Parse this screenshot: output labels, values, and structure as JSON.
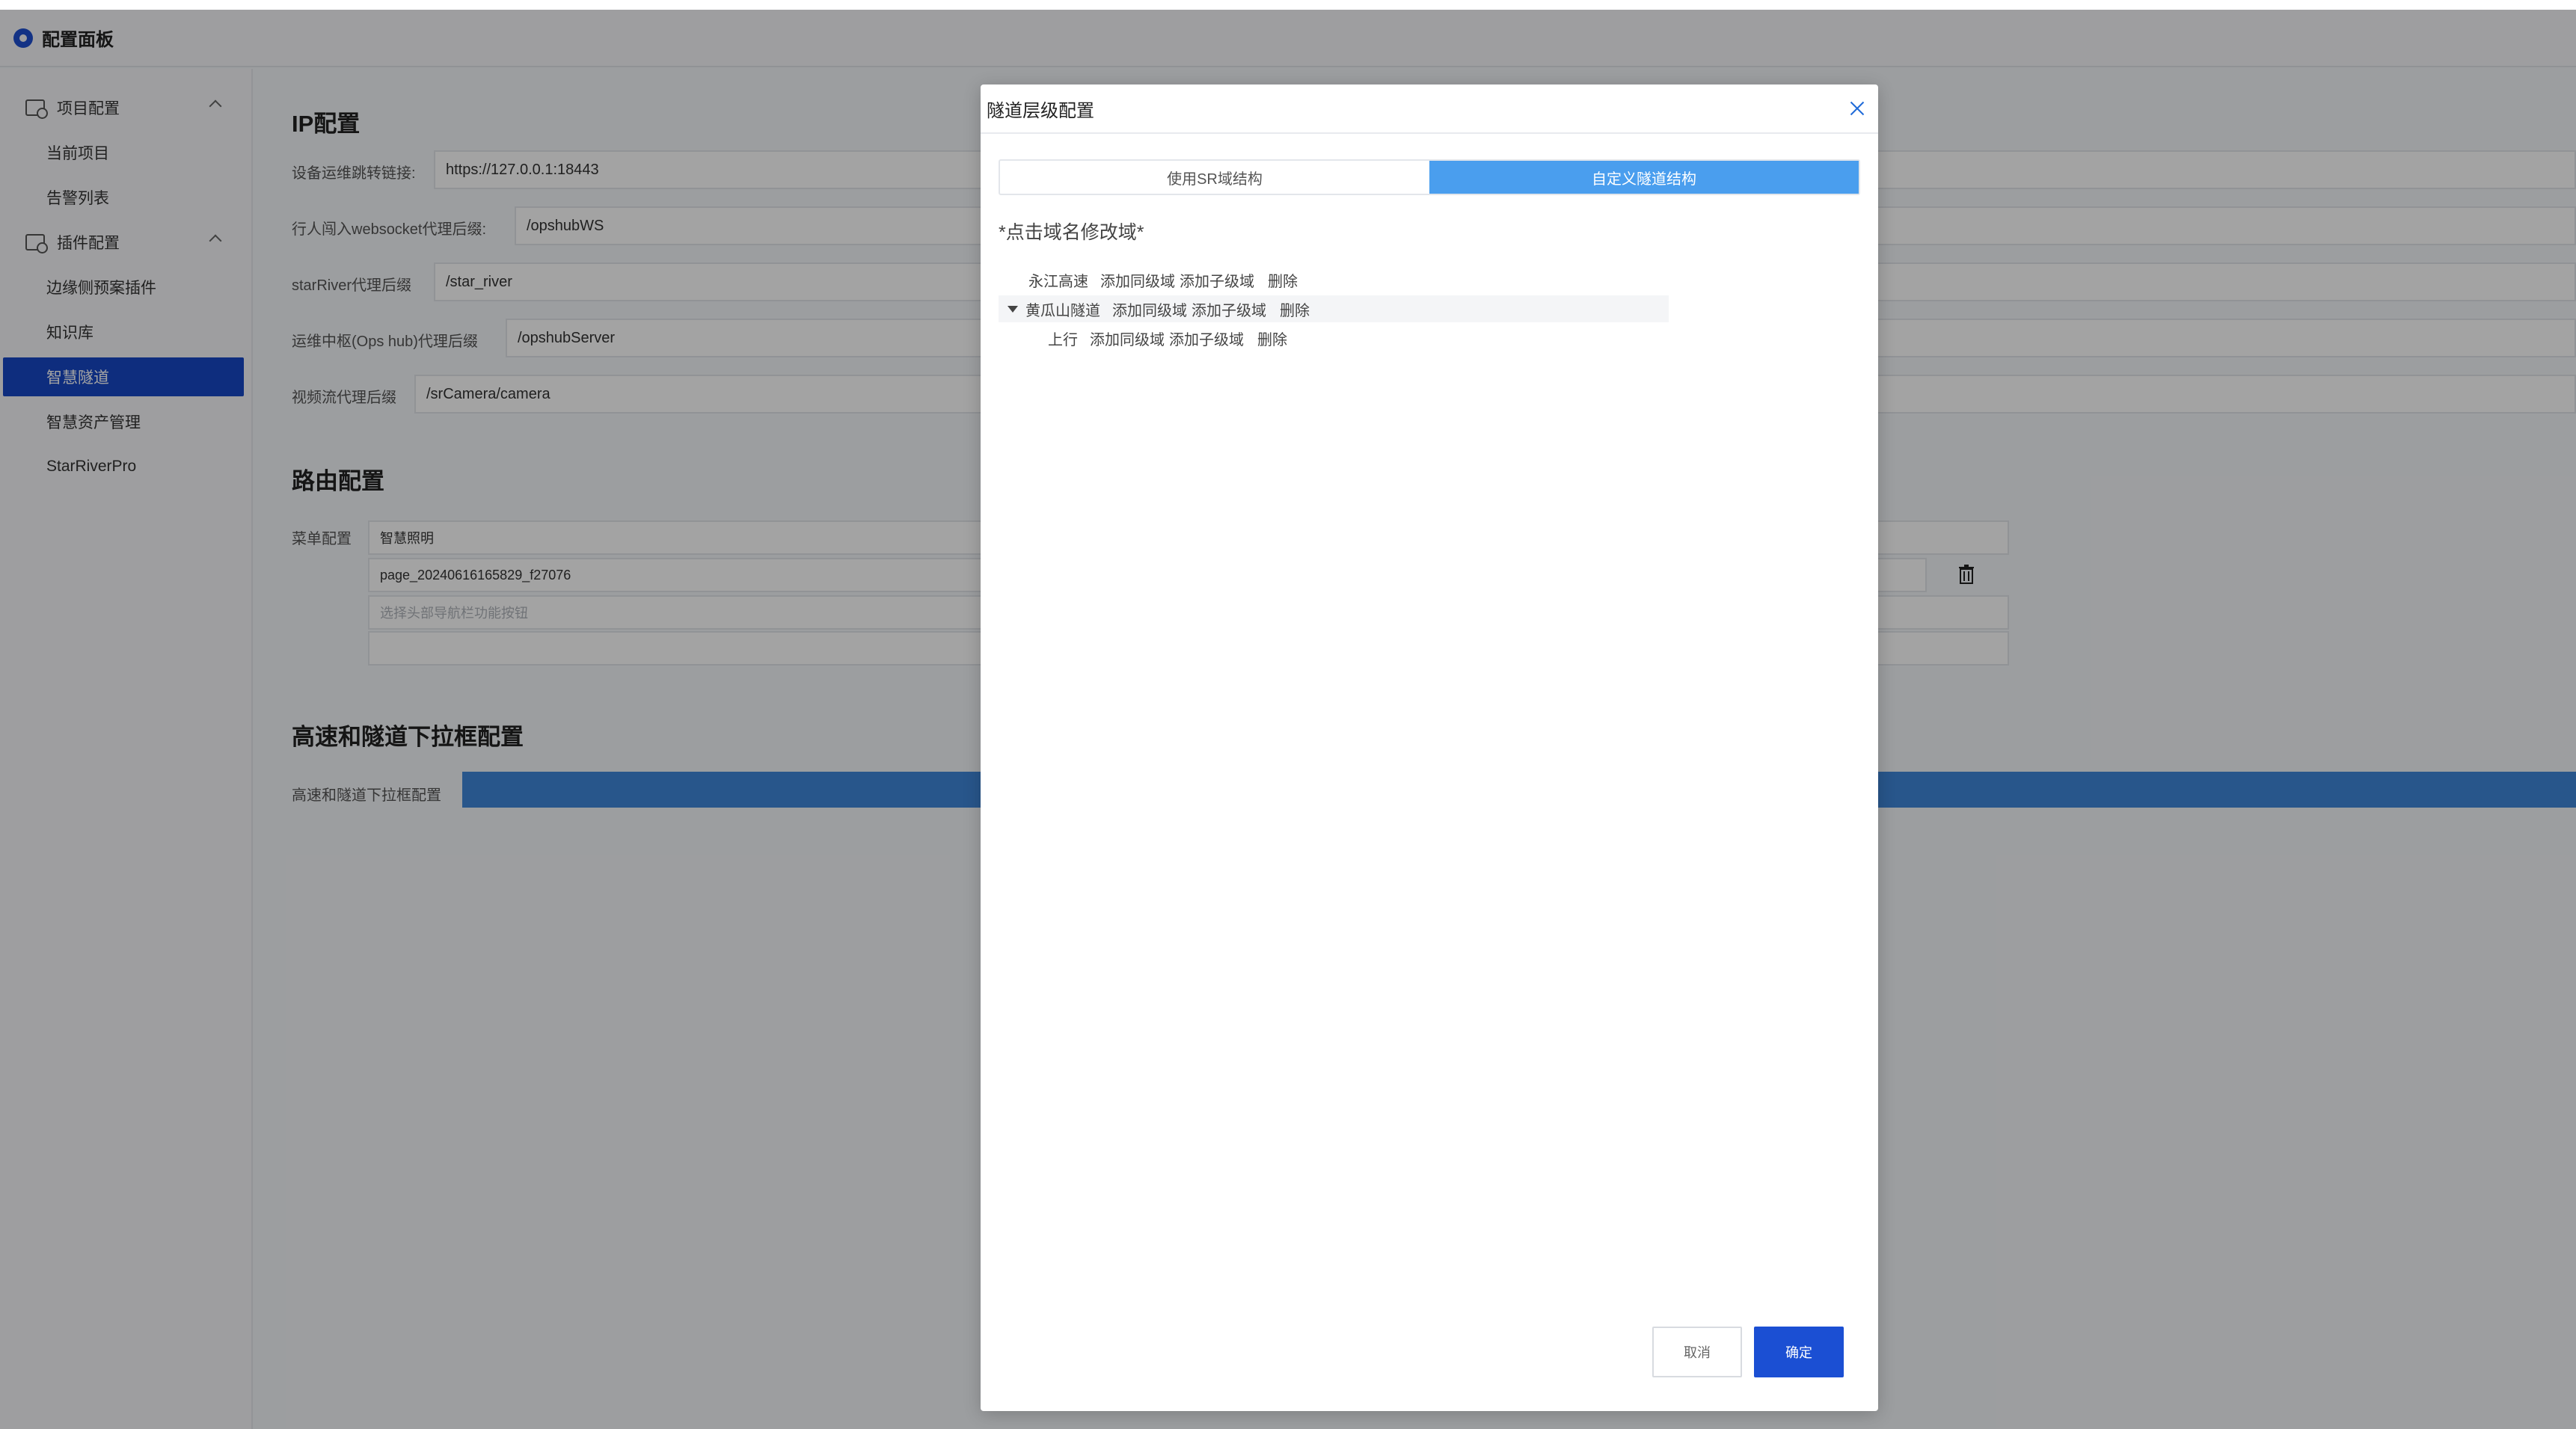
{
  "header": {
    "title": "配置面板"
  },
  "sidebar": {
    "groups": [
      {
        "label": "项目配置",
        "items": [
          "当前项目",
          "告警列表"
        ]
      },
      {
        "label": "插件配置",
        "items": [
          "边缘侧预案插件",
          "知识库",
          "智慧隧道",
          "智慧资产管理",
          "StarRiverPro"
        ]
      }
    ],
    "active_item": "智慧隧道"
  },
  "main": {
    "ip_section": {
      "title": "IP配置",
      "fields": [
        {
          "label": "设备运维跳转链接:",
          "value": "https://127.0.0.1:18443"
        },
        {
          "label": "行人闯入websocket代理后缀:",
          "value": "/opshubWS"
        },
        {
          "label": "starRiver代理后缀",
          "value": "/star_river"
        },
        {
          "label": "运维中枢(Ops hub)代理后缀",
          "value": "/opshubServer"
        },
        {
          "label": "视频流代理后缀",
          "value": "/srCamera/camera"
        }
      ]
    },
    "route_section": {
      "title": "路由配置",
      "menu_label": "菜单配置",
      "menu_name": "智慧照明",
      "page_id": "page_20240616165829_f27076",
      "select_placeholder": "选择头部导航栏功能按钮"
    },
    "dropdown_section": {
      "title": "高速和隧道下拉框配置",
      "label": "高速和隧道下拉框配置"
    }
  },
  "modal": {
    "title": "隧道层级配置",
    "tabs": [
      "使用SR域结构",
      "自定义隧道结构"
    ],
    "active_tab": 1,
    "hint": "*点击域名修改域*",
    "tree": [
      {
        "name": "永江高速",
        "level": 0,
        "expanded": false,
        "actions": [
          "添加同级域",
          "添加子级域",
          "删除"
        ]
      },
      {
        "name": "黄瓜山隧道",
        "level": 0,
        "expanded": true,
        "actions": [
          "添加同级域",
          "添加子级域",
          "删除"
        ]
      },
      {
        "name": "上行",
        "level": 1,
        "expanded": false,
        "actions": [
          "添加同级域",
          "添加子级域",
          "删除"
        ]
      }
    ],
    "cancel_label": "取消",
    "ok_label": "确定"
  },
  "colors": {
    "primary": "#1b4fd3",
    "tab_active": "#4a9eee",
    "progress_bar": "#3f87d9"
  }
}
